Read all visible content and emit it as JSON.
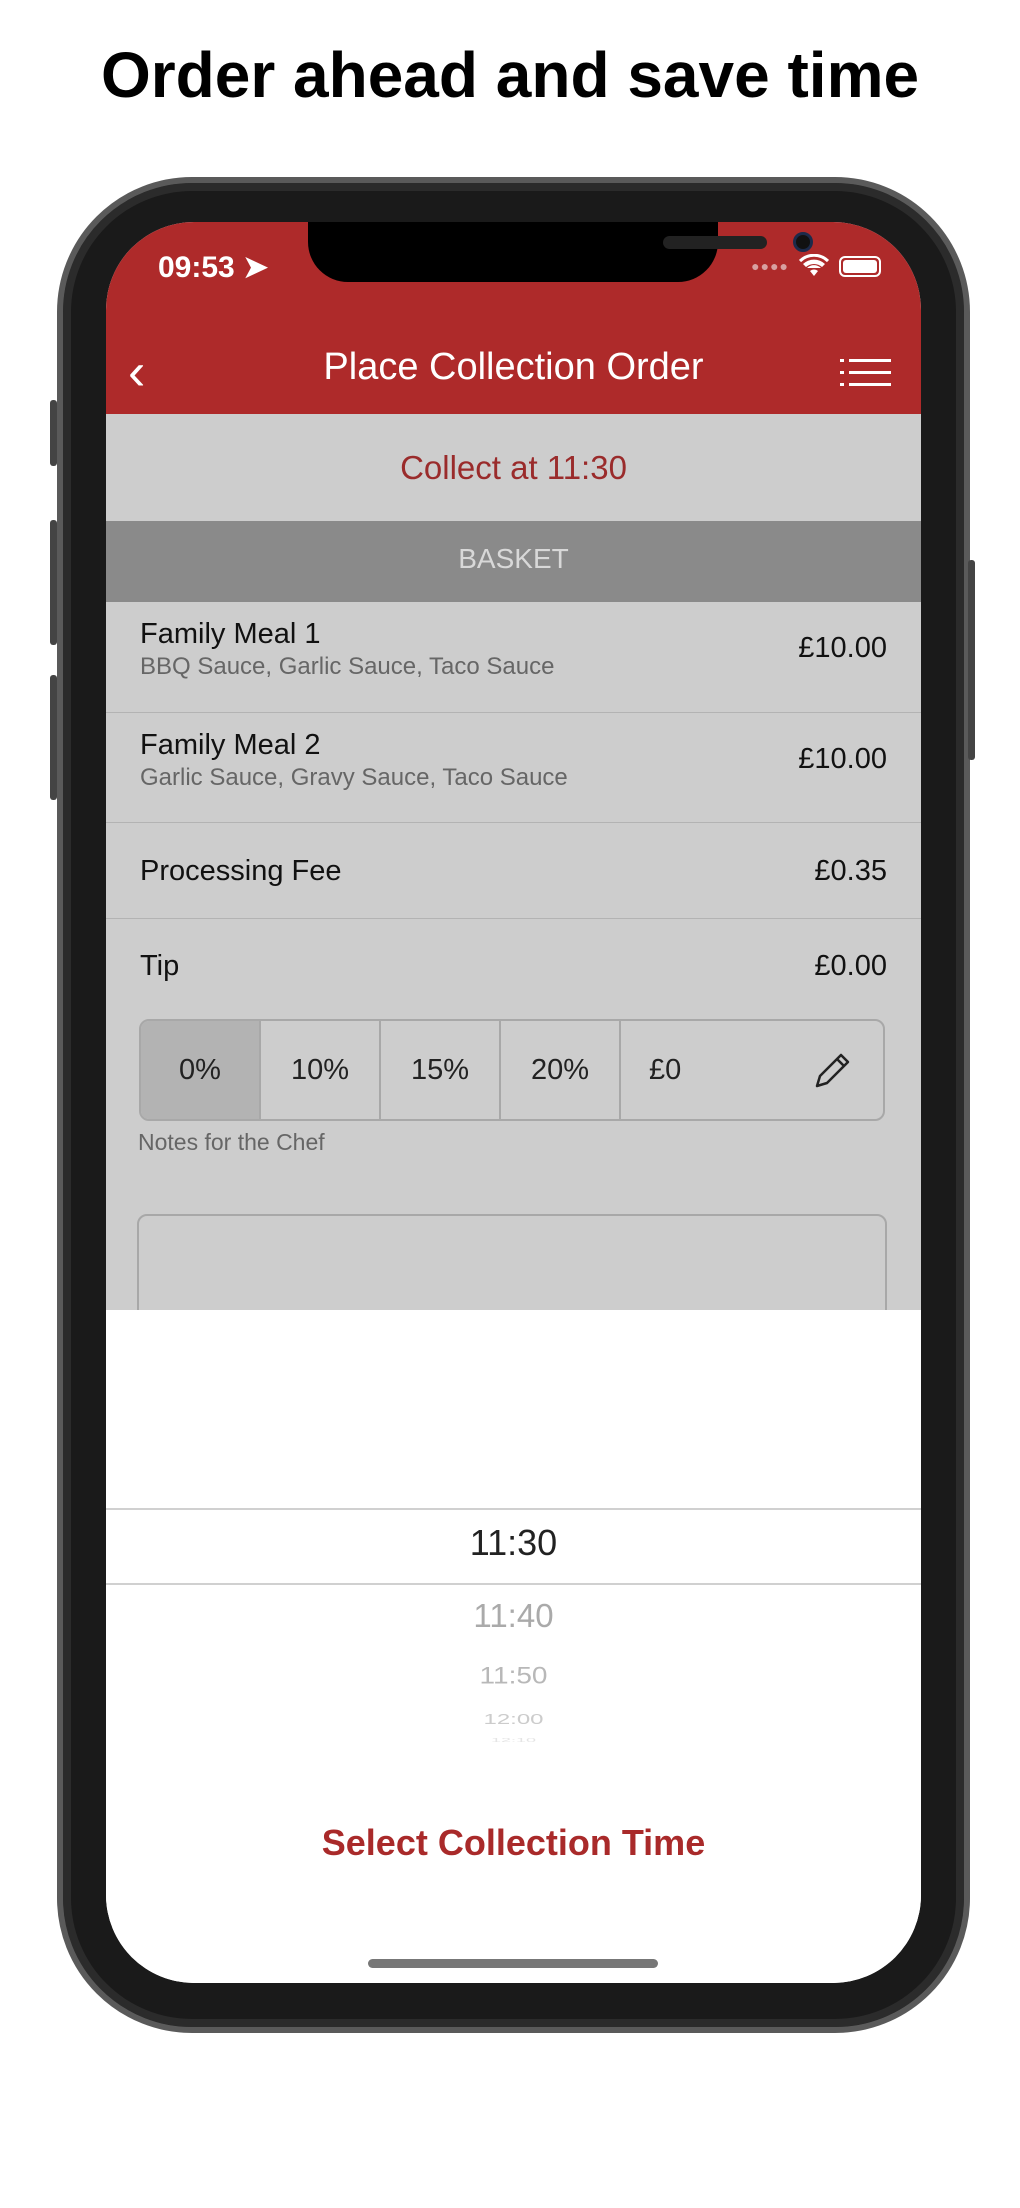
{
  "headline": "Order ahead and save time",
  "status_bar": {
    "time": "09:53",
    "icons": [
      "location-arrow-icon",
      "signal-icon",
      "wifi-icon",
      "battery-icon"
    ]
  },
  "nav": {
    "title": "Place Collection Order",
    "back_icon": "chevron-left-icon",
    "menu_icon": "list-icon"
  },
  "collect_at": "Collect at 11:30",
  "basket_header": "BASKET",
  "items": [
    {
      "name": "Family Meal 1",
      "options": "BBQ Sauce, Garlic Sauce, Taco Sauce",
      "price": "£10.00"
    },
    {
      "name": "Family Meal 2",
      "options": "Garlic Sauce, Gravy Sauce, Taco Sauce",
      "price": "£10.00"
    }
  ],
  "processing_fee": {
    "label": "Processing Fee",
    "value": "£0.35"
  },
  "tip": {
    "label": "Tip",
    "value": "£0.00",
    "options": [
      "0%",
      "10%",
      "15%",
      "20%"
    ],
    "selected": "0%",
    "custom": "£0"
  },
  "notes": {
    "label": "Notes for the Chef",
    "value": ""
  },
  "picker": {
    "selected": "11:30",
    "options": [
      "11:30",
      "11:40",
      "11:50",
      "12:00",
      "12:10"
    ]
  },
  "select_button": "Select Collection Time",
  "colors": {
    "brand": "#ae2a2a",
    "content_bg": "#cdcdcd",
    "basket_bg": "#8a8a8a"
  }
}
